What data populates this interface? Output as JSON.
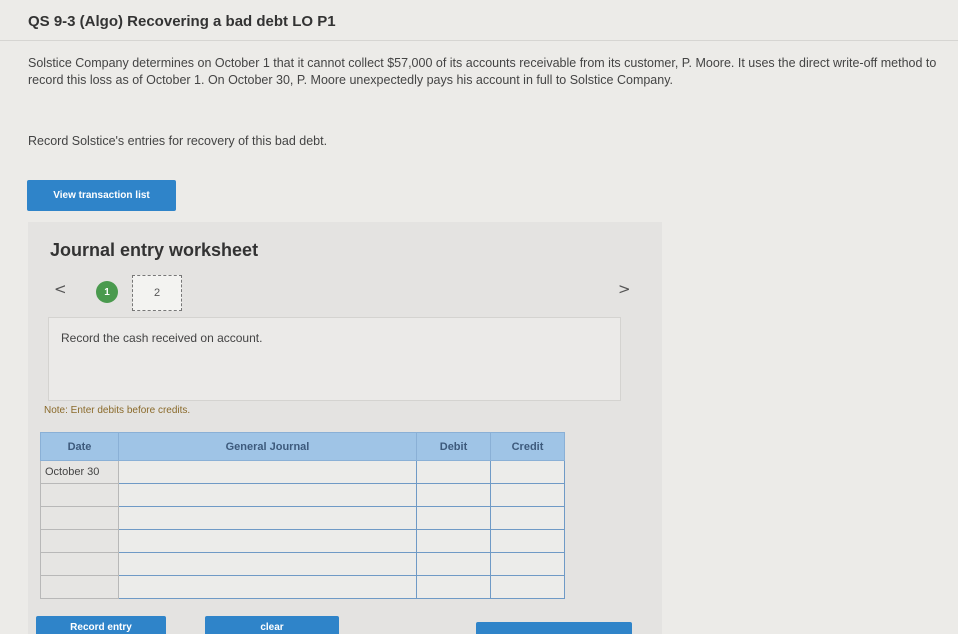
{
  "header": {
    "title": "QS 9-3 (Algo) Recovering a bad debt LO P1"
  },
  "problem": {
    "text": "Solstice Company determines on October 1 that it cannot collect $57,000 of its accounts receivable from its customer, P. Moore. It uses the direct write-off method to record this loss as of October 1. On October 30, P. Moore unexpectedly pays his account in full to Solstice Company.",
    "instruction": "Record Solstice's entries for recovery of this bad debt."
  },
  "buttons": {
    "view_transactions": "View transaction list",
    "record_entry": "Record entry",
    "clear": "clear"
  },
  "worksheet": {
    "title": "Journal entry worksheet",
    "prev": "<",
    "next": ">",
    "steps": [
      "1",
      "2"
    ],
    "current_step": 1,
    "description": "Record the cash received on account.",
    "note": "Note: Enter debits before credits."
  },
  "journal": {
    "headers": {
      "date": "Date",
      "general_journal": "General Journal",
      "debit": "Debit",
      "credit": "Credit"
    },
    "rows": [
      {
        "date": "October 30"
      },
      {
        "date": ""
      },
      {
        "date": ""
      },
      {
        "date": ""
      },
      {
        "date": ""
      },
      {
        "date": ""
      }
    ]
  },
  "colors": {
    "accent_blue": "#2f84c9",
    "header_blue": "#9fc4e6",
    "step_green": "#4a9a4e"
  }
}
